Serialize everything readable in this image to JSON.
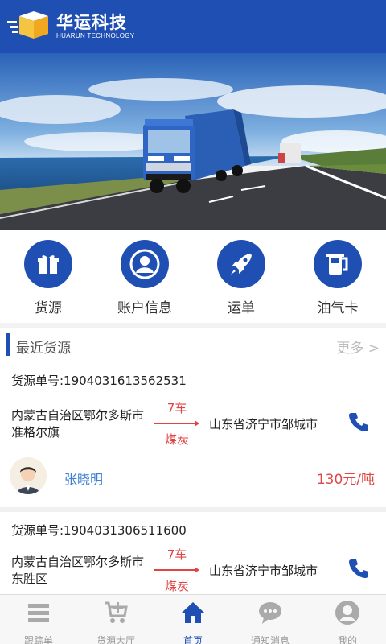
{
  "header": {
    "brand_cn": "华运科技",
    "brand_en": "HUARUN TECHNOLOGY",
    "logo_icon": "cube-logo-icon",
    "bg_color": "#1f4fb3"
  },
  "banner": {
    "image": "truck-on-highway-photo"
  },
  "quick_menu": [
    {
      "label": "货源",
      "icon": "gift-icon"
    },
    {
      "label": "账户信息",
      "icon": "user-icon"
    },
    {
      "label": "运单",
      "icon": "rocket-icon"
    },
    {
      "label": "油气卡",
      "icon": "fuel-card-icon"
    }
  ],
  "recent": {
    "title": "最近货源",
    "more": "更多 >",
    "items": [
      {
        "order_no": "货源单号:1904031613562531",
        "from": "内蒙古自治区鄂尔多斯市准格尔旗",
        "qty": "7车",
        "goods": "煤炭",
        "to": "山东省济宁市邹城市",
        "driver": "张晓明",
        "price": "130元/吨"
      },
      {
        "order_no": "货源单号:1904031306511600",
        "from": "内蒙古自治区鄂尔多斯市东胜区",
        "qty": "7车",
        "goods": "煤炭",
        "to": "山东省济宁市邹城市"
      }
    ]
  },
  "nav": {
    "items": [
      {
        "label": "跟踪单",
        "icon": "list-icon"
      },
      {
        "label": "货源大厅",
        "icon": "cart-plus-icon"
      },
      {
        "label": "首页",
        "icon": "home-icon",
        "active": true
      },
      {
        "label": "通知消息",
        "icon": "chat-icon"
      },
      {
        "label": "我的",
        "icon": "profile-icon"
      }
    ]
  },
  "colors": {
    "primary": "#1f4fb3",
    "accent_red": "#e04545",
    "link_blue": "#3a7fd5"
  }
}
